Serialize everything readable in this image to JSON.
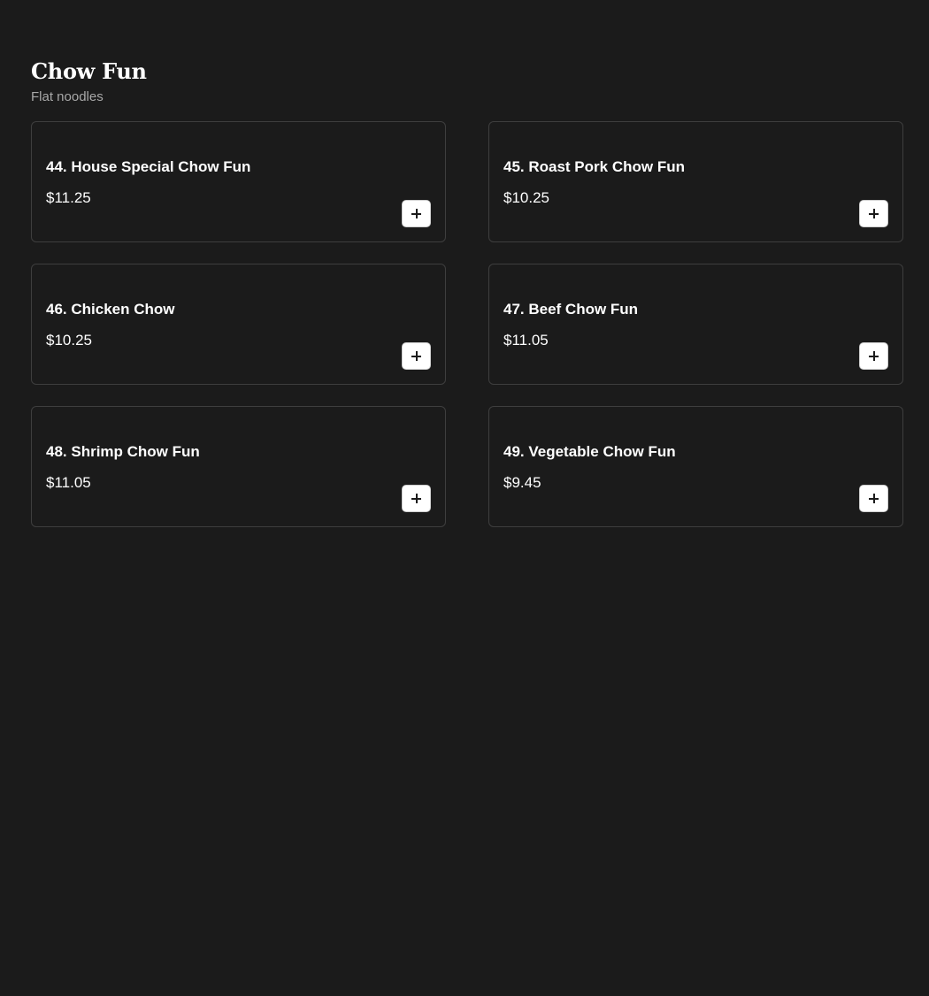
{
  "section": {
    "title": "Chow Fun",
    "subtitle": "Flat noodles"
  },
  "items": [
    {
      "name": "44. House Special Chow Fun",
      "price": "$11.25"
    },
    {
      "name": "45. Roast Pork Chow Fun",
      "price": "$10.25"
    },
    {
      "name": "46. Chicken Chow",
      "price": "$10.25"
    },
    {
      "name": "47. Beef Chow Fun",
      "price": "$11.05"
    },
    {
      "name": "48. Shrimp Chow Fun",
      "price": "$11.05"
    },
    {
      "name": "49. Vegetable Chow Fun",
      "price": "$9.45"
    }
  ],
  "icons": {
    "add": "plus-icon"
  },
  "colors": {
    "background": "#1b1b1b",
    "card_border": "#3e3e3e",
    "text": "#ffffff",
    "subtitle": "#a8a8a8",
    "button_bg": "#ffffff"
  }
}
